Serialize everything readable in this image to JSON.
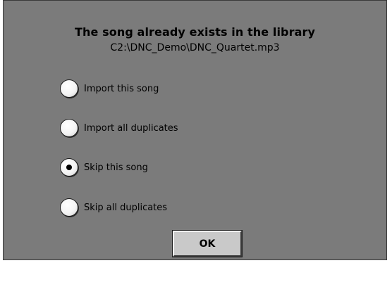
{
  "dialog": {
    "title": "The song already exists in the library",
    "path": "C2:\\DNC_Demo\\DNC_Quartet.mp3",
    "options": [
      {
        "label": "Import this song",
        "checked": false
      },
      {
        "label": "Import all duplicates",
        "checked": false
      },
      {
        "label": "Skip this song",
        "checked": true
      },
      {
        "label": "Skip all duplicates",
        "checked": false
      }
    ],
    "ok_label": "OK"
  },
  "colors": {
    "dialog_background": "#7b7b7b",
    "button_face": "#c9c9c9"
  }
}
